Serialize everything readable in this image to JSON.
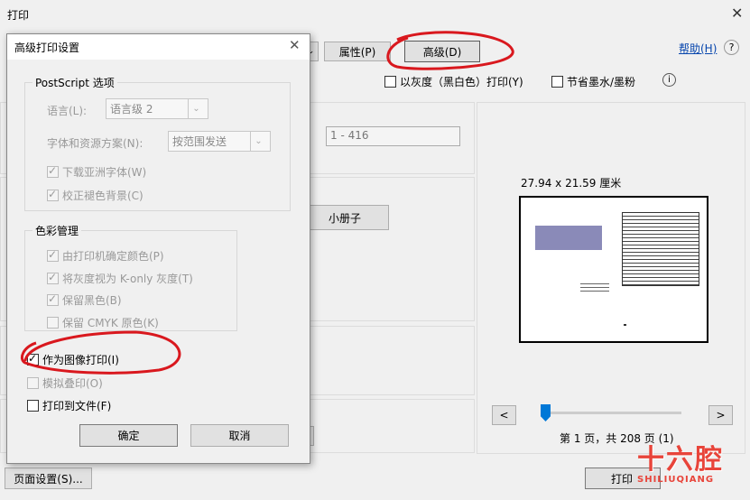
{
  "window": {
    "title": "打印"
  },
  "toolbar": {
    "properties_label": "属性(P)",
    "advanced_label": "高级(D)",
    "help_label": "帮助(H)",
    "grayscale_label": "以灰度（黑白色）打印(Y)",
    "save_ink_label": "节省墨水/墨粉"
  },
  "pages": {
    "range_value": "1 - 416"
  },
  "booklet": {
    "label": "小册子"
  },
  "preview": {
    "size_label": "27.94 x 21.59 厘米",
    "page_status": "第 1 页，共 208 页 (1)",
    "prev_label": "<",
    "next_label": ">"
  },
  "footer": {
    "page_setup_label": "页面设置(S)...",
    "print_label": "打印"
  },
  "watermark": {
    "main": "十六腔",
    "sub": "SHILIUQIANG"
  },
  "dialog": {
    "title": "高级打印设置",
    "postscript": {
      "title": "PostScript 选项",
      "language_label": "语言(L):",
      "language_value": "语言级 2",
      "font_label": "字体和资源方案(N):",
      "font_value": "按范围发送",
      "download_asian": "下载亚洲字体(W)",
      "correct_bg": "校正褪色背景(C)"
    },
    "color": {
      "title": "色彩管理",
      "printer_color": "由打印机确定颜色(P)",
      "gray_konly": "将灰度视为 K-only 灰度(T)",
      "keep_black": "保留黑色(B)",
      "keep_cmyk": "保留 CMYK 原色(K)"
    },
    "print_as_image": "作为图像打印(I)",
    "emulate_overprint": "模拟叠印(O)",
    "print_to_file": "打印到文件(F)",
    "ok_label": "确定",
    "cancel_label": "取消"
  },
  "colors": {
    "accent_red": "#d9181e",
    "link_blue": "#0645ad"
  },
  "icons": {
    "close": "close-icon",
    "info": "info-icon",
    "dropdown": "chevron-down-icon"
  }
}
